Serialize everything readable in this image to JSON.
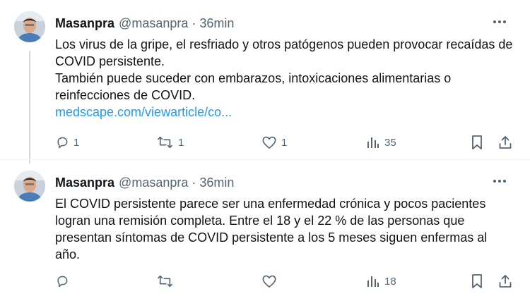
{
  "tweets": [
    {
      "author": {
        "name": "Masanpra",
        "handle": "@masanpra",
        "time": "36min",
        "avatar_icon": "user-avatar"
      },
      "body": {
        "line1": "Los virus de la gripe, el resfriado y otros patógenos pueden provocar recaídas de COVID persistente.",
        "line2": "También puede suceder con embarazos, intoxicaciones alimentarias o reinfecciones de COVID.",
        "link": "medscape.com/viewarticle/co..."
      },
      "stats": {
        "replies": "1",
        "retweets": "1",
        "likes": "1",
        "views": "35"
      }
    },
    {
      "author": {
        "name": "Masanpra",
        "handle": "@masanpra",
        "time": "36min",
        "avatar_icon": "user-avatar"
      },
      "body": {
        "text": "El COVID persistente parece ser una enfermedad crónica y pocos pacientes logran una remisión completa. Entre el 18 y el 22 % de las personas que presentan síntomas de COVID persistente a los 5 meses siguen enfermas al año."
      },
      "stats": {
        "replies": "",
        "retweets": "",
        "likes": "",
        "views": "18"
      }
    }
  ],
  "separator": "·",
  "colors": {
    "text": "#0f1419",
    "secondary": "#536471",
    "link": "#1d9bf0",
    "thread_line": "#cfd9de",
    "divider": "#eff3f4"
  },
  "icons": [
    "more-icon",
    "reply-icon",
    "retweet-icon",
    "like-icon",
    "views-icon",
    "bookmark-icon",
    "share-icon"
  ]
}
